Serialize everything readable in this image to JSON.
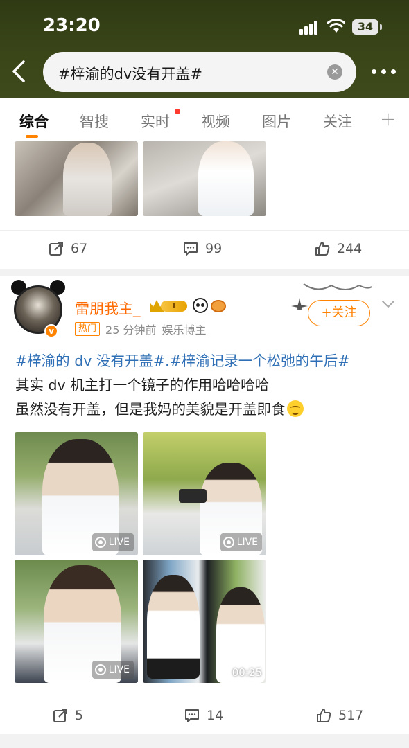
{
  "status_bar": {
    "time": "23:20",
    "battery": "34"
  },
  "search": {
    "query": "#梓渝的dv没有开盖#"
  },
  "tabs": [
    {
      "label": "综合",
      "active": true
    },
    {
      "label": "智搜"
    },
    {
      "label": "实时",
      "dot": true
    },
    {
      "label": "视频"
    },
    {
      "label": "图片"
    },
    {
      "label": "关注"
    }
  ],
  "colors": {
    "accent": "#ff8200",
    "topic": "#2f6fb5",
    "header_bg": "#3a4618"
  },
  "post1": {
    "actions": {
      "repost": "67",
      "comment": "99",
      "like": "244"
    }
  },
  "post2": {
    "username": "雷朋我主_",
    "level_badge": "I",
    "hot_tag": "热门",
    "time_ago": "25 分钟前",
    "category": "娱乐博主",
    "follow_label": "+关注",
    "topic1": "#梓渝的 dv 没有开盖#",
    "separator": ".",
    "topic2": "#梓渝记录一个松弛的午后#",
    "line2": "其实 dv 机主打一个镜子的作用哈哈哈哈",
    "line3": "虽然没有开盖，但是我妈的美貌是开盖即食",
    "images": [
      {
        "badge": "LIVE"
      },
      {
        "badge": "LIVE"
      },
      {
        "badge": "LIVE"
      },
      {
        "duration": "00:25"
      }
    ],
    "actions": {
      "repost": "5",
      "comment": "14",
      "like": "517"
    }
  },
  "icons": [
    "back-arrow-icon",
    "clear-icon",
    "more-icon",
    "plus-icon",
    "repost-icon",
    "comment-icon",
    "like-icon",
    "live-icon",
    "chevron-down-icon",
    "verified-icon"
  ]
}
